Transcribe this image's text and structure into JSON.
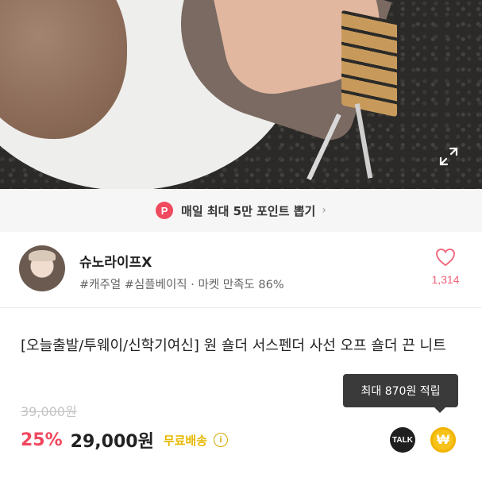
{
  "promo": {
    "badge": "P",
    "text": "매일 최대 5만 포인트 뽑기",
    "chevron": "›"
  },
  "seller": {
    "name": "슈노라이프X",
    "tags": "#캐주얼 #심플베이직 · 마켓 만족도 86%",
    "likes": "1,314"
  },
  "product": {
    "title": "[오늘출발/투웨이/신학기여신] 원 숄더 서스펜더 사선 오프 숄더 끈 니트",
    "original_price": "39,000원",
    "discount": "25%",
    "price": "29,000원",
    "shipping": "무료배송",
    "info_glyph": "i"
  },
  "tooltip": {
    "text": "최대 870원 적립"
  },
  "buttons": {
    "talk": "TALK",
    "won": "₩"
  },
  "icons": [
    "expand-icon",
    "heart-icon",
    "info-icon",
    "chevron-right-icon"
  ],
  "colors": {
    "accent_pink": "#f0475e",
    "shipping_yellow": "#e6b800",
    "won_yellow": "#f7c21a"
  }
}
